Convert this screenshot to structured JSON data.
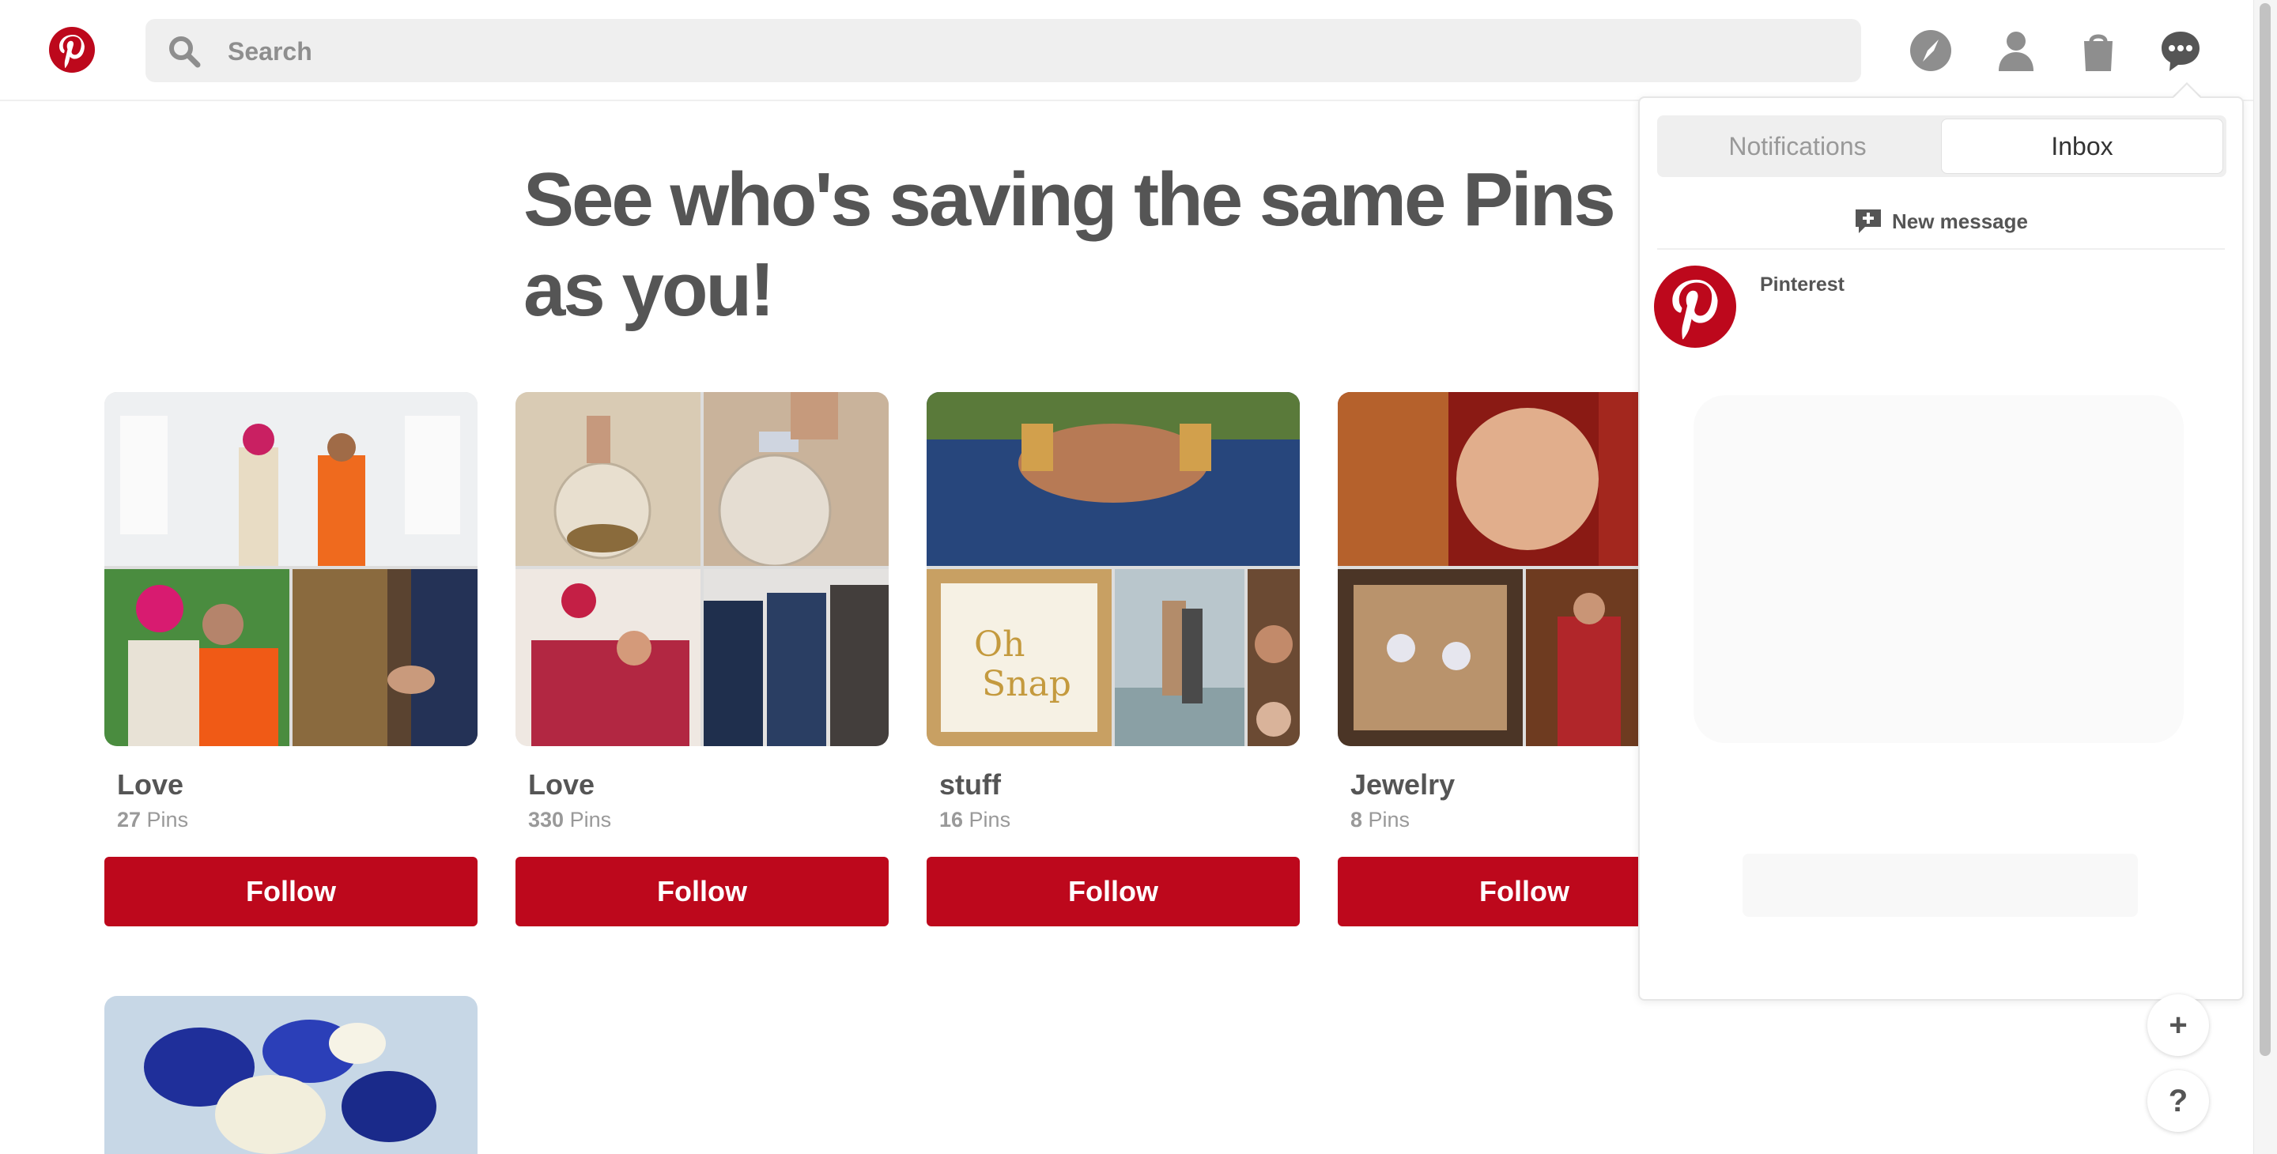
{
  "header": {
    "search_placeholder": "Search",
    "icons": [
      "pinterest-logo-icon",
      "search-icon",
      "explore-compass-icon",
      "profile-icon",
      "shopping-bag-icon",
      "messages-icon"
    ]
  },
  "main": {
    "title": "See who's saving the same Pins as you!",
    "boards": [
      {
        "name": "Love",
        "count": "27",
        "count_suffix": " Pins",
        "follow_label": "Follow"
      },
      {
        "name": "Love",
        "count": "330",
        "count_suffix": " Pins",
        "follow_label": "Follow"
      },
      {
        "name": "stuff",
        "count": "16",
        "count_suffix": " Pins",
        "follow_label": "Follow"
      },
      {
        "name": "Jewelry",
        "count": "8",
        "count_suffix": " Pins",
        "follow_label": "Follow"
      }
    ]
  },
  "flyout": {
    "tabs": [
      {
        "label": "Notifications",
        "active": false
      },
      {
        "label": "Inbox",
        "active": true
      }
    ],
    "new_message_label": "New message",
    "conversations": [
      {
        "name": "Pinterest"
      }
    ]
  },
  "fabs": {
    "add_label": "+",
    "help_label": "?"
  },
  "colors": {
    "brand_red": "#bd081c",
    "header_icon_gray": "#8e8e8e",
    "search_bg": "#efefef"
  }
}
